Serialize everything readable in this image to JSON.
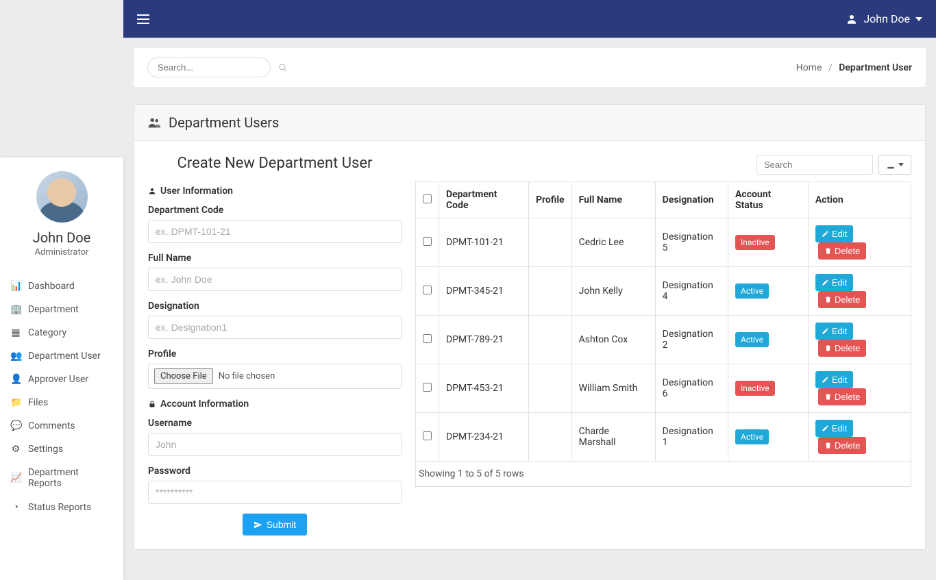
{
  "topbar": {
    "user_name": "John Doe"
  },
  "profile": {
    "name": "John Doe",
    "role": "Administrator"
  },
  "sidebar": {
    "items": [
      {
        "label": "Dashboard"
      },
      {
        "label": "Department"
      },
      {
        "label": "Category"
      },
      {
        "label": "Department User"
      },
      {
        "label": "Approver User"
      },
      {
        "label": "Files"
      },
      {
        "label": "Comments"
      },
      {
        "label": "Settings"
      },
      {
        "label": "Department Reports"
      },
      {
        "label": "Status Reports"
      }
    ]
  },
  "toolbar": {
    "search_placeholder": "Search...",
    "breadcrumb_home": "Home",
    "breadcrumb_current": "Department User"
  },
  "panel": {
    "title": "Department Users"
  },
  "form": {
    "title": "Create New Department User",
    "section_user": "User Information",
    "section_account": "Account Information",
    "dept_code_label": "Department Code",
    "dept_code_placeholder": "ex. DPMT-101-21",
    "fullname_label": "Full Name",
    "fullname_placeholder": "ex. John Doe",
    "designation_label": "Designation",
    "designation_placeholder": "ex. Designation1",
    "profile_label": "Profile",
    "choose_file": "Choose File",
    "no_file": "No file chosen",
    "username_label": "Username",
    "username_placeholder": "John",
    "password_label": "Password",
    "password_placeholder": "**********",
    "submit": "Submit"
  },
  "table": {
    "search_placeholder": "Search",
    "headers": {
      "dept_code": "Department Code",
      "profile": "Profile",
      "fullname": "Full Name",
      "designation": "Designation",
      "status": "Account Status",
      "action": "Action"
    },
    "actions": {
      "edit": "Edit",
      "delete": "Delete"
    },
    "rows": [
      {
        "code": "DPMT-101-21",
        "name": "Cedric Lee",
        "designation": "Designation 5",
        "status": "Inactive"
      },
      {
        "code": "DPMT-345-21",
        "name": "John Kelly",
        "designation": "Designation 4",
        "status": "Active"
      },
      {
        "code": "DPMT-789-21",
        "name": "Ashton Cox",
        "designation": "Designation 2",
        "status": "Active"
      },
      {
        "code": "DPMT-453-21",
        "name": "William Smith",
        "designation": "Designation 6",
        "status": "Inactive"
      },
      {
        "code": "DPMT-234-21",
        "name": "Charde Marshall",
        "designation": "Designation 1",
        "status": "Active"
      }
    ],
    "footer": "Showing 1 to 5 of 5 rows"
  }
}
